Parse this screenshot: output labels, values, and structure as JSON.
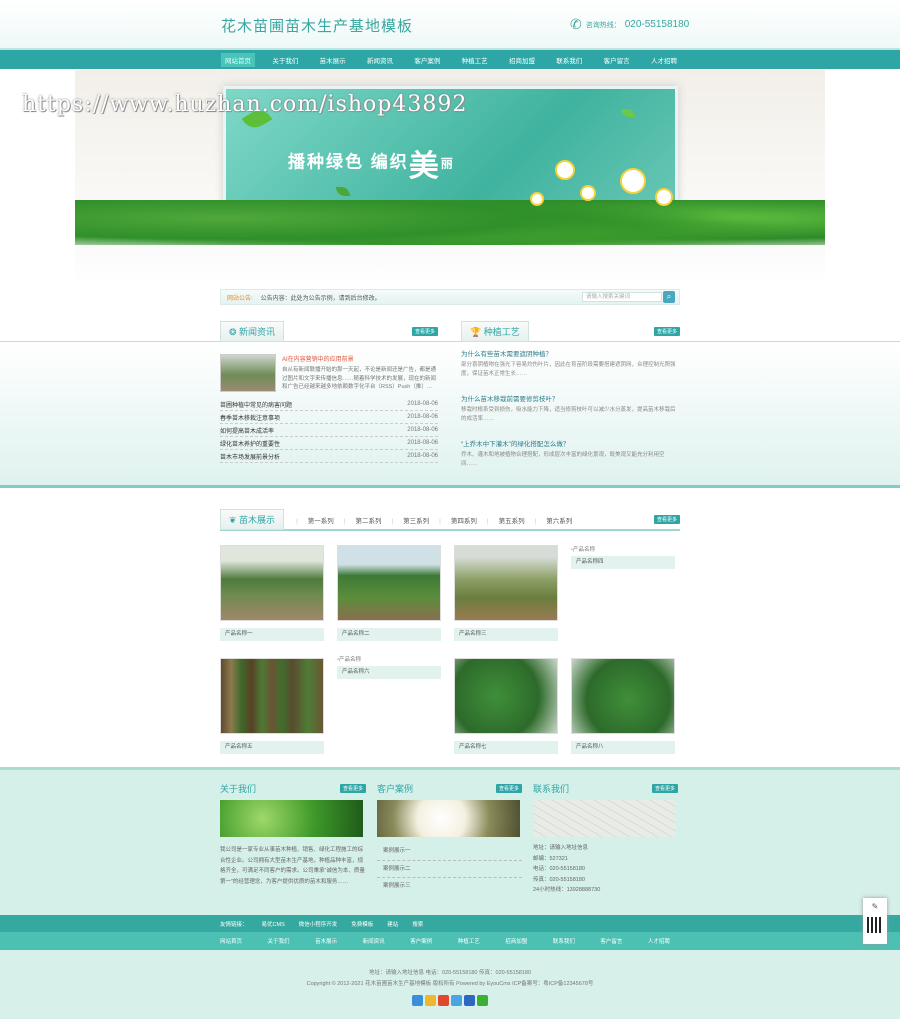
{
  "header": {
    "title": "花木苗圃苗木生产基地模板",
    "phone_label": "咨询热线：",
    "phone": "020-55158180"
  },
  "nav": [
    "网站首页",
    "关于我们",
    "苗木展示",
    "新闻资讯",
    "客户案例",
    "种植工艺",
    "招商加盟",
    "联系我们",
    "客户留言",
    "人才招聘"
  ],
  "banner": {
    "slogan_a": "播种绿色",
    "slogan_b": "编织",
    "slogan_c": "美",
    "slogan_d": "丽",
    "watermark": "https://www.huzhan.com/ishop43892"
  },
  "notice": {
    "label": "网站公告:",
    "text": "公告内容：此处为公告示例，请到后台修改。",
    "search_placeholder": "请输入搜索关键词",
    "search_icon": "search-icon"
  },
  "news": {
    "title": "新闻资讯",
    "more": "查看更多",
    "featured_title": "AI在内容营销中的应用前景",
    "featured_text": "自从有新闻联播开始的那一天起，不论是新闻还是广告，都是通过图片和文字来传播信息……随着科学技术的发展，现在的新闻和广告已经越来越多地依赖数字化平台（RSS）Push（推）…[详细]",
    "items": [
      {
        "t": "苗圃种植中常见的病害问题",
        "d": "2018-08-06"
      },
      {
        "t": "春季苗木移栽注意事项",
        "d": "2018-08-06"
      },
      {
        "t": "如何提高苗木成活率",
        "d": "2018-08-06"
      },
      {
        "t": "绿化苗木养护的重要性",
        "d": "2018-08-06"
      },
      {
        "t": "苗木市场发展前景分析",
        "d": "2018-08-06"
      }
    ]
  },
  "craft": {
    "title": "种植工艺",
    "more": "查看更多",
    "items": [
      {
        "q": "为什么有些苗木需要遮阴种植？",
        "a": "部分喜阴植物在强光下容易灼伤叶片，因此在育苗阶段需要搭建遮阴网，合理控制光照强度，保证苗木正常生长……"
      },
      {
        "q": "为什么苗木移栽前需要修剪枝叶？",
        "a": "移栽时根系受到损伤，吸水能力下降，适当修剪枝叶可以减少水分蒸发，提高苗木移栽后的成活率……"
      },
      {
        "q": "“上乔木中下灌木”的绿化搭配怎么做？",
        "a": "乔木、灌木和地被植物合理搭配，形成层次丰富的绿化景观，既美观又能充分利用空间……"
      }
    ]
  },
  "products": {
    "title": "苗木展示",
    "more": "查看更多",
    "categories": [
      "第一系列",
      "第二系列",
      "第三系列",
      "第四系列",
      "第五系列",
      "第六系列"
    ],
    "row1": [
      "产品名称一",
      "产品名称二",
      "产品名称三",
      "产品名称四"
    ],
    "row2": [
      "产品名称五",
      "产品名称六",
      "产品名称七",
      "产品名称八"
    ],
    "broken_alt": "产品名称"
  },
  "footer": {
    "about_title": "关于我们",
    "about_text": "我公司是一家专业从事苗木种植、销售、绿化工程施工的综合性企业。公司拥有大型苗木生产基地，种植品种丰富，规格齐全，可满足不同客户的需求。公司秉承“诚信为本、质量第一”的经营理念，为客户提供优质的苗木和服务……",
    "case_title": "客户案例",
    "cases": [
      "案例展示一",
      "案例展示二",
      "案例展示三"
    ],
    "contact_title": "联系我们",
    "contact": [
      "地址：请输入地址信息",
      "邮编：527321",
      "电话：020-55158180",
      "传真：020-55158180",
      "24小时热线：13928888730"
    ],
    "more": "查看更多"
  },
  "links": [
    "友情链接：",
    "易优CMS",
    "微信小程序开发",
    "免费模板",
    "建站",
    "搜索"
  ],
  "nav2": [
    "网站首页",
    "关于我们",
    "苗木展示",
    "新闻资讯",
    "客户案例",
    "种植工艺",
    "招商加盟",
    "联系我们",
    "客户留言",
    "人才招聘"
  ],
  "copyright": {
    "line1": "地址：请输入地址信息   电话：020-55158180   传真：020-55158180",
    "line2": "Copyright © 2012-2021 花木苗圃苗木生产基地模板 版权所有 Powered by EyouCms    ICP备案号：粤ICP备12345678号"
  },
  "colors": {
    "accent": "#2fa6a6",
    "light": "#d5efe9"
  }
}
